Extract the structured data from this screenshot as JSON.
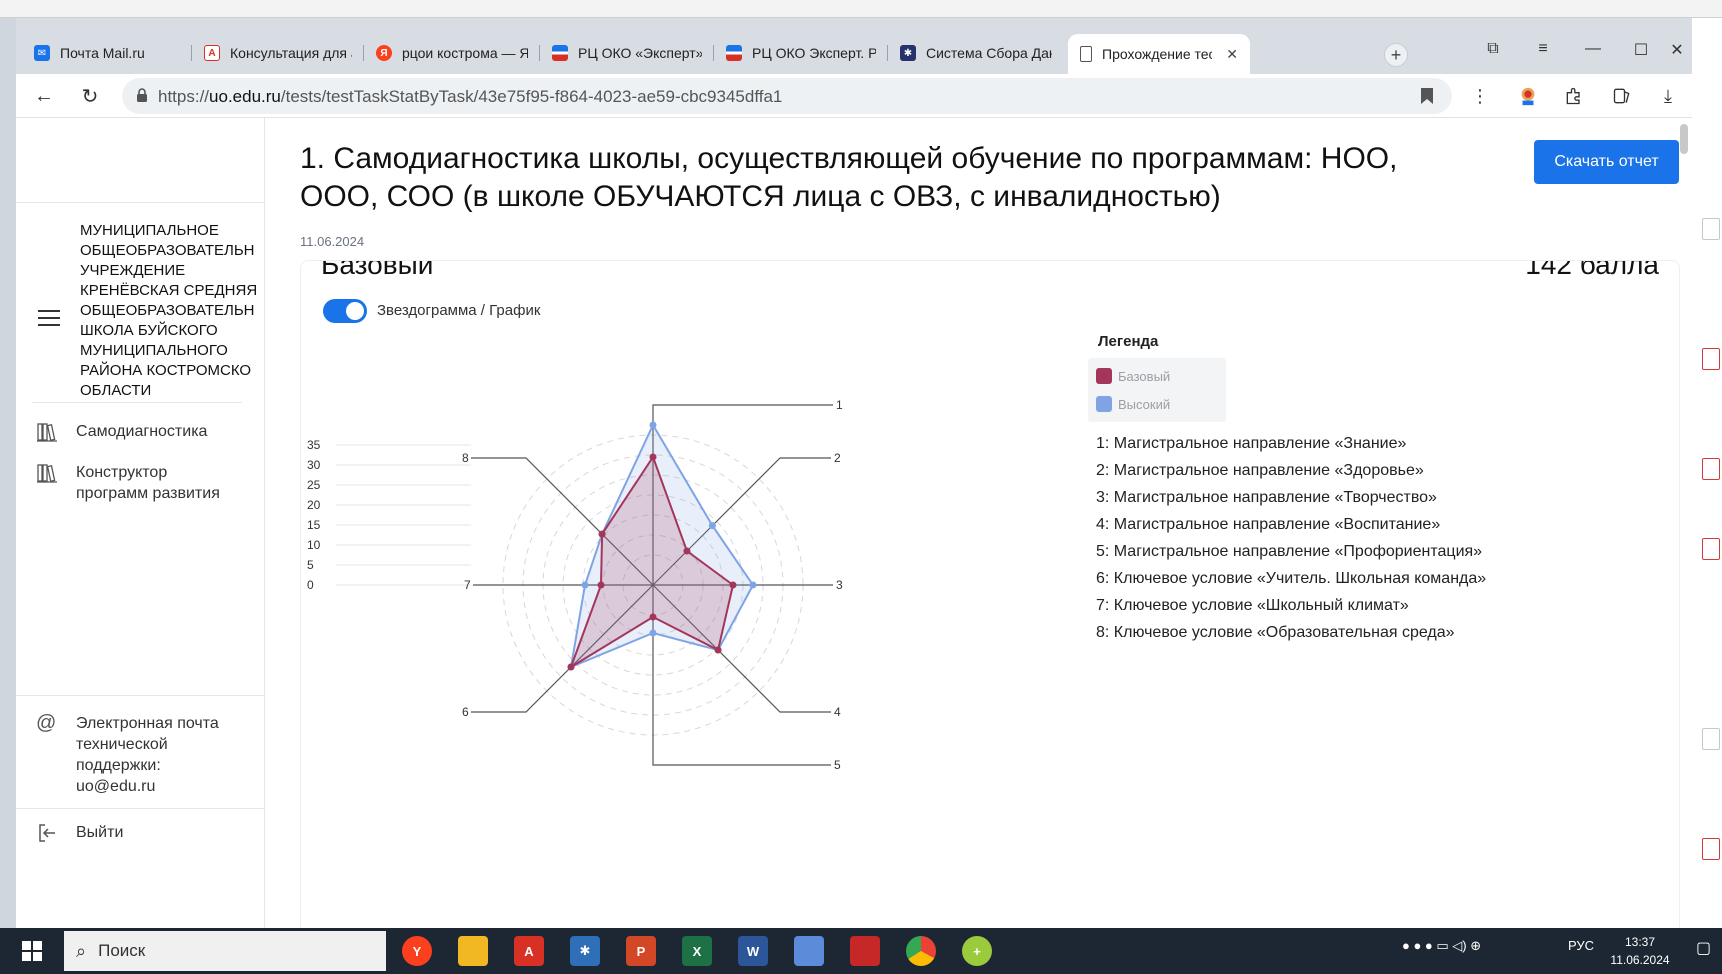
{
  "browser": {
    "tabs": [
      {
        "title": "Почта Mail.ru",
        "favicon": "mail-icon",
        "color": "#1a73e8"
      },
      {
        "title": "Консультация для ад",
        "favicon": "pdf-icon",
        "color": "#d93025"
      },
      {
        "title": "рцои кострома — Ян",
        "favicon": "yandex-icon",
        "color": "#fc3f1d"
      },
      {
        "title": "РЦ ОКО «Эксперт». С",
        "favicon": "flag-icon",
        "color": "#1a73e8"
      },
      {
        "title": "РЦ ОКО Эксперт. Ре",
        "favicon": "flag-icon",
        "color": "#1a73e8"
      },
      {
        "title": "Система Сбора Данн",
        "favicon": "system-icon",
        "color": "#24346b"
      },
      {
        "title": "Прохождение тес",
        "favicon": "document-icon",
        "color": "#555555",
        "active": true
      }
    ],
    "url_prefix": "https://",
    "url_domain": "uo.edu.ru",
    "url_path": "/tests/testTaskStatByTask/43e75f95-f864-4023-ae59-cbc9345dffa1"
  },
  "sidebar": {
    "org_name": "МУНИЦИПАЛЬНОЕ\nОБЩЕОБРАЗОВАТЕЛЬН\nУЧРЕЖДЕНИЕ\nКРЕНЁВСКАЯ СРЕДНЯЯ\nОБЩЕОБРАЗОВАТЕЛЬН\nШКОЛА БУЙСКОГО\nМУНИЦИПАЛЬНОГО\nРАЙОНА КОСТРОМСКО\nОБЛАСТИ",
    "items": [
      {
        "label": "Самодиагностика",
        "icon": "books-icon"
      },
      {
        "label": "Конструктор программ развития",
        "icon": "books-icon"
      }
    ],
    "support_label": "Электронная почта технической поддержки: uo@edu.ru",
    "logout_label": "Выйти"
  },
  "main": {
    "title": "1. Самодиагностика школы, осуществляющей обучение по программам: НОО, ООО, СОО (в школе ОБУЧАЮТСЯ лица с ОВЗ, с инвалидностью)",
    "date": "11.06.2024",
    "download_label": "Скачать отчет",
    "level": "Базовый",
    "score": "142 балла",
    "toggle_label": "Звездограмма / График",
    "legend_title": "Легенда",
    "series_labels": [
      "Базовый",
      "Высокий"
    ],
    "axis_items": [
      "1: Магистральное направление «Знание»",
      "2: Магистральное направление «Здоровье»",
      "3: Магистральное направление «Творчество»",
      "4: Магистральное направление «Воспитание»",
      "5: Магистральное направление «Профориентация»",
      "6: Ключевое условие «Учитель. Школьная команда»",
      "7: Ключевое условие «Школьный климат»",
      "8: Ключевое условие «Образовательная среда»"
    ]
  },
  "chart_data": {
    "type": "radar",
    "axes": [
      "1",
      "2",
      "3",
      "4",
      "5",
      "6",
      "7",
      "8"
    ],
    "scale_ticks": [
      "35",
      "30",
      "25",
      "20",
      "15",
      "10",
      "5",
      "0"
    ],
    "ylim": [
      0,
      35
    ],
    "series": [
      {
        "name": "Базовый",
        "values": [
          32,
          12,
          20,
          23,
          8,
          29,
          13,
          18
        ],
        "color": "#a3365a"
      },
      {
        "name": "Высокий",
        "values": [
          40,
          21,
          25,
          23,
          12,
          29,
          17,
          18
        ],
        "color": "#7ea4e6"
      }
    ]
  },
  "taskbar": {
    "search_label": "Поиск",
    "lang": "РУС",
    "time": "13:37",
    "date": "11.06.2024"
  },
  "colors": {
    "accent": "#1a73e8",
    "series_base": "#a3365a",
    "series_high": "#7ea4e6"
  }
}
